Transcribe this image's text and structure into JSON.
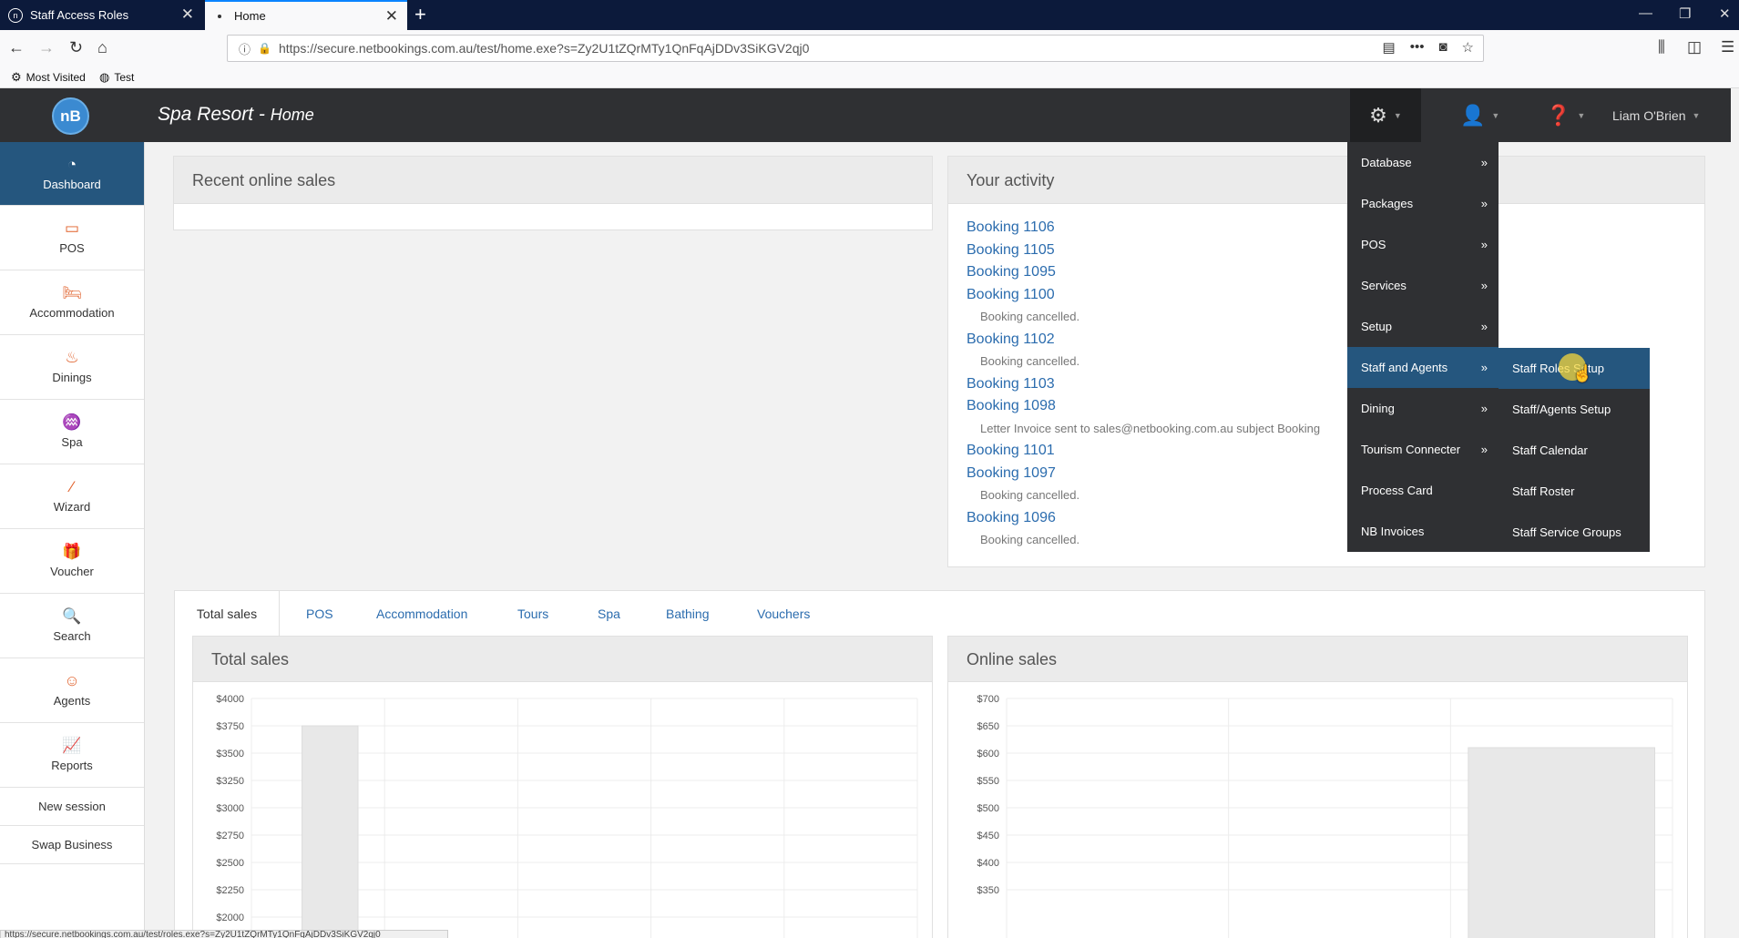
{
  "browser": {
    "tabs": [
      {
        "label": "Staff Access Roles"
      },
      {
        "label": "Home"
      }
    ],
    "url": "https://secure.netbookings.com.au/test/home.exe?s=Zy2U1tZQrMTy1QnFqAjDDv3SiKGV2qj0",
    "bookmarks": [
      {
        "label": "Most Visited"
      },
      {
        "label": "Test"
      }
    ],
    "status_url": "https://secure.netbookings.com.au/test/roles.exe?s=Zy2U1tZQrMTy1QnFqAjDDv3SiKGV2qj0"
  },
  "app": {
    "logo_text": "nB",
    "title": "Spa Resort - ",
    "subtitle": "Home",
    "user_name": "Liam O'Brien"
  },
  "sidebar": {
    "items": [
      {
        "label": "Dashboard",
        "icon": "dashboard-icon",
        "active": true
      },
      {
        "label": "POS",
        "icon": "pos-icon"
      },
      {
        "label": "Accommodation",
        "icon": "bed-icon"
      },
      {
        "label": "Dinings",
        "icon": "dining-icon"
      },
      {
        "label": "Spa",
        "icon": "spa-icon"
      },
      {
        "label": "Wizard",
        "icon": "wand-icon"
      },
      {
        "label": "Voucher",
        "icon": "gift-icon"
      },
      {
        "label": "Search",
        "icon": "search-icon"
      },
      {
        "label": "Agents",
        "icon": "agent-icon"
      },
      {
        "label": "Reports",
        "icon": "chart-icon"
      }
    ],
    "links": [
      {
        "label": "New session"
      },
      {
        "label": "Swap Business"
      }
    ]
  },
  "recent_sales": {
    "title": "Recent online sales"
  },
  "activity": {
    "title": "Your activity",
    "entries": [
      {
        "link": "Booking 1106"
      },
      {
        "link": "Booking 1105"
      },
      {
        "link": "Booking 1095"
      },
      {
        "link": "Booking 1100",
        "note": "Booking cancelled."
      },
      {
        "link": "Booking 1102",
        "note": "Booking cancelled."
      },
      {
        "link": "Booking 1103"
      },
      {
        "link": "Booking 1098",
        "note": "Letter Invoice sent to sales@netbooking.com.au subject Booking"
      },
      {
        "link": "Booking 1101"
      },
      {
        "link": "Booking 1097",
        "note": "Booking cancelled."
      },
      {
        "link": "Booking 1096",
        "note": "Booking cancelled."
      }
    ]
  },
  "sales_tabs": [
    {
      "label": "Total sales",
      "active": true
    },
    {
      "label": "POS"
    },
    {
      "label": "Accommodation"
    },
    {
      "label": "Tours"
    },
    {
      "label": "Spa"
    },
    {
      "label": "Bathing"
    },
    {
      "label": "Vouchers"
    }
  ],
  "settings_menu": {
    "items": [
      {
        "label": "Database",
        "has_submenu": true
      },
      {
        "label": "Packages",
        "has_submenu": true
      },
      {
        "label": "POS",
        "has_submenu": true
      },
      {
        "label": "Services",
        "has_submenu": true
      },
      {
        "label": "Setup",
        "has_submenu": true
      },
      {
        "label": "Staff and Agents",
        "has_submenu": true,
        "active": true
      },
      {
        "label": "Dining",
        "has_submenu": true
      },
      {
        "label": "Tourism Connecter",
        "has_submenu": true
      },
      {
        "label": "Process Card"
      },
      {
        "label": "NB Invoices"
      }
    ],
    "arrow": "»",
    "submenu": [
      {
        "label": "Staff Roles Setup",
        "active": true
      },
      {
        "label": "Staff/Agents Setup"
      },
      {
        "label": "Staff Calendar"
      },
      {
        "label": "Staff Roster"
      },
      {
        "label": "Staff Service Groups"
      }
    ]
  },
  "chart_data": [
    {
      "type": "bar",
      "title": "Total sales",
      "yticks": [
        "$4000",
        "$3750",
        "$3500",
        "$3250",
        "$3000",
        "$2750",
        "$2500",
        "$2250",
        "$2000"
      ],
      "ylim": [
        2000,
        4000
      ],
      "categories": [
        "",
        "",
        "",
        "",
        ""
      ],
      "values": [
        3750,
        null,
        null,
        null,
        null
      ],
      "grid": true,
      "bar_color": "#e8e8e8"
    },
    {
      "type": "bar",
      "title": "Online sales",
      "yticks": [
        "$700",
        "$650",
        "$600",
        "$550",
        "$500",
        "$450",
        "$400",
        "$350"
      ],
      "ylim": [
        350,
        700
      ],
      "categories": [
        "",
        "",
        ""
      ],
      "values": [
        null,
        null,
        610
      ],
      "grid": true,
      "bar_color": "#e8e8e8"
    }
  ]
}
